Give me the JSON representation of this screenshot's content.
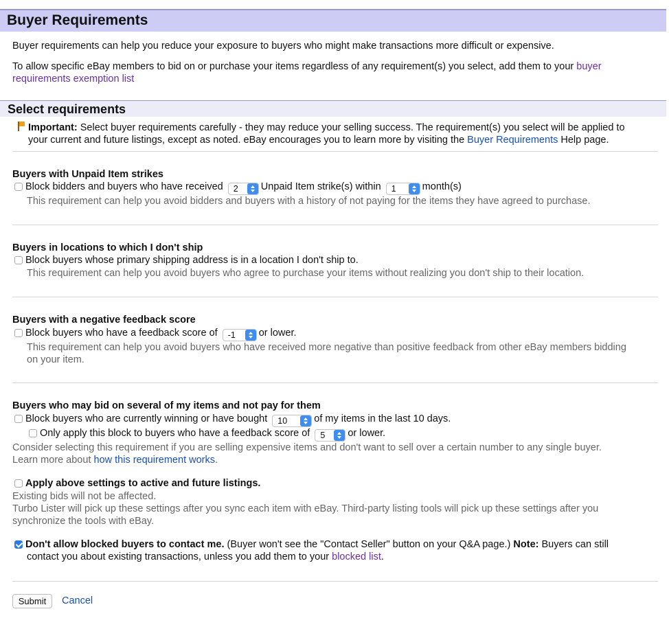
{
  "header": {
    "title": "Buyer Requirements"
  },
  "intro": {
    "line1": "Buyer requirements can help you reduce your exposure to buyers who might make transactions more difficult or expensive.",
    "line2_pre": "To allow specific eBay members to bid on or purchase your items regardless of any requirement(s) you select, add them to your",
    "exemption_link_a": "buyer",
    "exemption_link_b": "requirements exemption list"
  },
  "section": {
    "title": "Select requirements"
  },
  "important": {
    "label": "Important:",
    "text_a": "Select buyer requirements carefully - they may reduce your selling success. The requirement(s) you select will be applied to",
    "text_b": "your current and future listings, except as noted. eBay encourages you to learn more by visiting the",
    "link": "Buyer Requirements",
    "text_c": "Help page."
  },
  "unpaid": {
    "heading": "Buyers with Unpaid Item strikes",
    "checked": false,
    "label_pre": "Block bidders and buyers who have received",
    "strikes_value": "2",
    "label_mid": "Unpaid Item strike(s) within",
    "months_value": "1",
    "label_post": "month(s)",
    "help": "This requirement can help you avoid bidders and buyers with a history of not paying for the items they have agreed to purchase."
  },
  "locations": {
    "heading": "Buyers in locations to which I don't ship",
    "checked": false,
    "label": "Block buyers whose primary shipping address is in a location I don't ship to.",
    "help": "This requirement can help you avoid buyers who agree to purchase your items without realizing you don't ship to their location."
  },
  "feedback": {
    "heading": "Buyers with a negative feedback score",
    "checked": false,
    "label_pre": "Block buyers who have a feedback score of",
    "score_value": "-1",
    "label_post": "or lower.",
    "help_a": "This requirement can help you avoid buyers who have received more negative than positive feedback from other eBay members bidding",
    "help_b": "on your item."
  },
  "several": {
    "heading": "Buyers who may bid on several of my items and not pay for them",
    "checked": false,
    "label_pre": "Block buyers who are currently winning or have bought",
    "count_value": "10",
    "label_post": "of my items in the last 10 days.",
    "sub_checked": false,
    "sub_label_pre": "Only apply this block to buyers who have a feedback score of",
    "sub_score_value": "5",
    "sub_label_post": "or lower.",
    "help_a": "Consider selecting this requirement if you are selling expensive items and don't want to sell over a certain number to any single buyer.",
    "help_b_pre": "Learn more about",
    "help_link": "how this requirement works",
    "help_b_post": "."
  },
  "apply": {
    "checked": false,
    "label": "Apply above settings to active and future listings.",
    "note1": "Existing bids will not be affected.",
    "note2a": "Turbo Lister will pick up these settings after you sync each item with eBay. Third-party listing tools will pick up these settings after you",
    "note2b": "synchronize the tools with eBay."
  },
  "contact": {
    "checked": true,
    "label_bold": "Don't allow blocked buyers to contact me.",
    "label_text": "(Buyer won't see the \"Contact Seller\" button on your Q&A page.)",
    "note_label": "Note:",
    "note_text": "Buyers can still",
    "line2_pre": "contact you about existing transactions, unless you add them to your",
    "link": "blocked list",
    "line2_post": "."
  },
  "actions": {
    "submit": "Submit",
    "cancel": "Cancel"
  },
  "colors": {
    "header_bg": "#ccccf4",
    "section_bg": "#ececf9",
    "link_blue": "#1a4fb8",
    "link_purple": "#6a2fa8",
    "checkbox_checked": "#2b7be4"
  }
}
